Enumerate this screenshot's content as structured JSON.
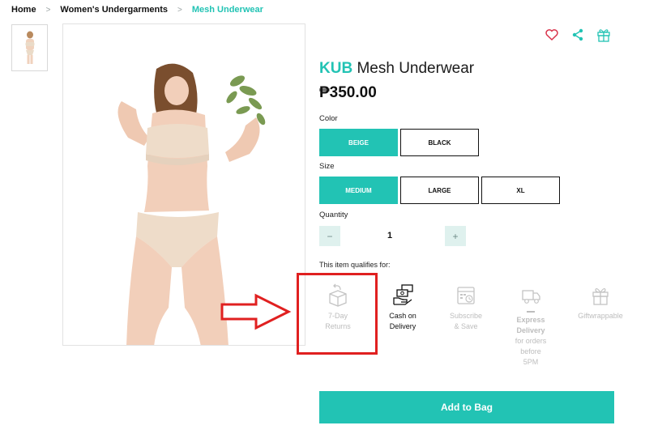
{
  "breadcrumb": {
    "items": [
      "Home",
      "Women's Undergarments",
      "Mesh Underwear"
    ]
  },
  "product": {
    "brand": "KUB",
    "name": "Mesh Underwear",
    "price": "₱350.00"
  },
  "color": {
    "label": "Color",
    "options": [
      "BEIGE",
      "BLACK"
    ],
    "selected": "BEIGE"
  },
  "size": {
    "label": "Size",
    "options": [
      "MEDIUM",
      "LARGE",
      "XL"
    ],
    "selected": "MEDIUM"
  },
  "quantity": {
    "label": "Quantity",
    "value": "1",
    "minus": "−",
    "plus": "+"
  },
  "qualifies": {
    "label": "This item qualifies for:",
    "features": [
      {
        "line1": "7-Day",
        "line2": "Returns",
        "icon": "return-box-icon",
        "enabled": false
      },
      {
        "line1": "Cash on",
        "line2": "Delivery",
        "icon": "cash-delivery-icon",
        "enabled": true
      },
      {
        "line1": "Subscribe",
        "line2": "& Save",
        "icon": "calendar-clock-icon",
        "enabled": false
      },
      {
        "line1": "Express",
        "line2": "Delivery",
        "line3": "for orders",
        "line4": "before",
        "line5": "5PM",
        "icon": "delivery-truck-icon",
        "enabled": false
      },
      {
        "line1": "Giftwrappable",
        "icon": "gift-icon",
        "enabled": false
      }
    ]
  },
  "actions": {
    "add_to_bag": "Add to Bag"
  },
  "colors": {
    "accent": "#22c3b4",
    "annotation": "#e02020"
  }
}
